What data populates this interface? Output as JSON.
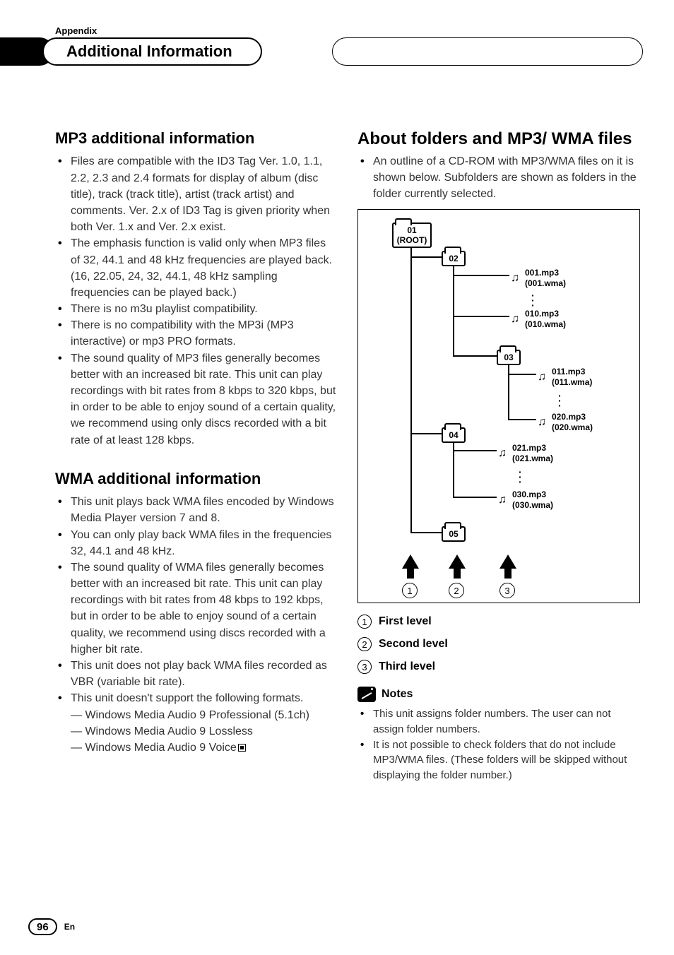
{
  "header": {
    "appendix": "Appendix",
    "title": "Additional Information"
  },
  "left": {
    "mp3_heading": "MP3 additional information",
    "mp3_bullets": [
      "Files are compatible with the ID3 Tag Ver. 1.0, 1.1, 2.2, 2.3 and 2.4 formats for display of album (disc title), track (track title), artist (track artist) and comments. Ver. 2.x of ID3 Tag is given priority when both Ver. 1.x and Ver. 2.x exist.",
      "The emphasis function is valid only when MP3 files of 32, 44.1 and 48 kHz frequencies are played back. (16, 22.05, 24, 32, 44.1, 48 kHz sampling frequencies can be played back.)",
      "There is no m3u playlist compatibility.",
      "There is no compatibility with the MP3i (MP3 interactive) or mp3 PRO formats.",
      "The sound quality of MP3 files generally becomes better with an increased bit rate. This unit can play recordings with bit rates from 8 kbps to 320 kbps, but in order to be able to enjoy sound of a certain quality, we recommend using only discs recorded with a bit rate of at least 128 kbps."
    ],
    "wma_heading": "WMA additional information",
    "wma_bullets": [
      "This unit plays back WMA files encoded by Windows Media Player version 7 and 8.",
      "You can only play back WMA files in the frequencies 32, 44.1 and 48 kHz.",
      "The sound quality of WMA files generally becomes better with an increased bit rate. This unit can play recordings with bit rates from 48 kbps to 192 kbps, but in order to be able to enjoy sound of a certain quality, we recommend using discs recorded with a higher bit rate.",
      "This unit does not play back WMA files recorded as VBR (variable bit rate).",
      "This unit doesn't support the following formats."
    ],
    "wma_subs": [
      "— Windows Media Audio 9 Professional (5.1ch)",
      "— Windows Media Audio 9 Lossless",
      "— Windows Media Audio 9 Voice"
    ]
  },
  "right": {
    "heading": "About folders and MP3/ WMA files",
    "intro": "An outline of a CD-ROM with MP3/WMA files on it is shown below. Subfolders are shown as folders in the folder currently selected.",
    "levels": [
      {
        "num": "1",
        "label": "First level"
      },
      {
        "num": "2",
        "label": "Second level"
      },
      {
        "num": "3",
        "label": "Third level"
      }
    ],
    "notes_label": "Notes",
    "notes": [
      "This unit assigns folder numbers. The user can not assign folder numbers.",
      "It is not possible to check folders that do not include MP3/WMA files. (These folders will be skipped without displaying the folder number.)"
    ]
  },
  "chart_data": {
    "type": "diagram",
    "description": "Folder/file tree of a CD-ROM with MP3/WMA files across three levels",
    "folders": [
      "01 (ROOT)",
      "02",
      "03",
      "04",
      "05"
    ],
    "files": [
      {
        "name": "001.mp3",
        "alt": "(001.wma)",
        "parent": "02"
      },
      {
        "name": "010.mp3",
        "alt": "(010.wma)",
        "parent": "02"
      },
      {
        "name": "011.mp3",
        "alt": "(011.wma)",
        "parent": "03"
      },
      {
        "name": "020.mp3",
        "alt": "(020.wma)",
        "parent": "03"
      },
      {
        "name": "021.mp3",
        "alt": "(021.wma)",
        "parent": "04"
      },
      {
        "name": "030.mp3",
        "alt": "(030.wma)",
        "parent": "04"
      }
    ],
    "level_markers": [
      "1",
      "2",
      "3"
    ]
  },
  "footer": {
    "page": "96",
    "lang": "En"
  }
}
